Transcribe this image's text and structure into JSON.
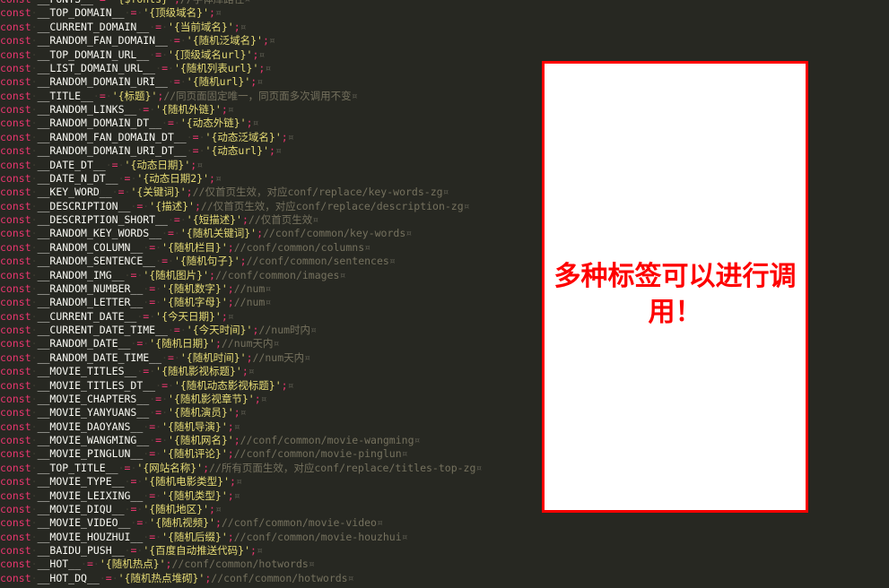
{
  "editor": {
    "theme_background": "#272822",
    "keyword_color": "#e8366f",
    "string_color": "#e6db74",
    "comment_color": "#75715e",
    "identifier_color": "#f8f8f2",
    "keyword": "const",
    "assign": "=",
    "terminator": ";",
    "quote": "'",
    "eol_mark": "¤",
    "lines": [
      {
        "name": "__FONTS__",
        "value": "{$fonts}",
        "comment": "//字体库路径"
      },
      {
        "name": "__TOP_DOMAIN__",
        "value": "{顶级域名}",
        "comment": ""
      },
      {
        "name": "__CURRENT_DOMAIN__",
        "value": "{当前域名}",
        "comment": ""
      },
      {
        "name": "__RANDOM_FAN_DOMAIN__",
        "value": "{随机泛域名}",
        "comment": ""
      },
      {
        "name": "__TOP_DOMAIN_URL__",
        "value": "{顶级域名url}",
        "comment": ""
      },
      {
        "name": "__LIST_DOMAIN_URL__",
        "value": "{随机列表url}",
        "comment": ""
      },
      {
        "name": "__RANDOM_DOMAIN_URI__",
        "value": "{随机url}",
        "comment": ""
      },
      {
        "name": "__TITLE__",
        "value": "{标题}",
        "comment": "//同页面固定唯一，同页面多次调用不变"
      },
      {
        "name": "__RANDOM_LINKS__",
        "value": "{随机外链}",
        "comment": ""
      },
      {
        "name": "__RANDOM_DOMAIN_DT__",
        "value": "{动态外链}",
        "comment": ""
      },
      {
        "name": "__RANDOM_FAN_DOMAIN_DT__",
        "value": "{动态泛域名}",
        "comment": ""
      },
      {
        "name": "__RANDOM_DOMAIN_URI_DT__",
        "value": "{动态url}",
        "comment": ""
      },
      {
        "name": "__DATE_DT__",
        "value": "{动态日期}",
        "comment": ""
      },
      {
        "name": "__DATE_N_DT__",
        "value": "{动态日期2}",
        "comment": ""
      },
      {
        "name": "__KEY_WORD__",
        "value": "{关键词}",
        "comment": "//仅首页生效，对应conf/replace/key-words-zg"
      },
      {
        "name": "__DESCRIPTION__",
        "value": "{描述}",
        "comment": "//仅首页生效，对应conf/replace/description-zg"
      },
      {
        "name": "__DESCRIPTION_SHORT__",
        "value": "{短描述}",
        "comment": "//仅首页生效"
      },
      {
        "name": "__RANDOM_KEY_WORDS__",
        "value": "{随机关键词}",
        "comment": "//conf/common/key-words"
      },
      {
        "name": "__RANDOM_COLUMN__",
        "value": "{随机栏目}",
        "comment": "//conf/common/columns"
      },
      {
        "name": "__RANDOM_SENTENCE__",
        "value": "{随机句子}",
        "comment": "//conf/common/sentences"
      },
      {
        "name": "__RANDOM_IMG__",
        "value": "{随机图片}",
        "comment": "//conf/common/images"
      },
      {
        "name": "__RANDOM_NUMBER__",
        "value": "{随机数字}",
        "comment": "//num"
      },
      {
        "name": "__RANDOM_LETTER__",
        "value": "{随机字母}",
        "comment": "//num"
      },
      {
        "name": "__CURRENT_DATE__",
        "value": "{今天日期}",
        "comment": ""
      },
      {
        "name": "__CURRENT_DATE_TIME__",
        "value": "{今天时间}",
        "comment": "//num时内"
      },
      {
        "name": "__RANDOM_DATE__",
        "value": "{随机日期}",
        "comment": "//num天内"
      },
      {
        "name": "__RANDOM_DATE_TIME__",
        "value": "{随机时间}",
        "comment": "//num天内"
      },
      {
        "name": "__MOVIE_TITLES__",
        "value": "{随机影视标题}",
        "comment": ""
      },
      {
        "name": "__MOVIE_TITLES_DT__",
        "value": "{随机动态影视标题}",
        "comment": ""
      },
      {
        "name": "__MOVIE_CHAPTERS__",
        "value": "{随机影视章节}",
        "comment": ""
      },
      {
        "name": "__MOVIE_YANYUANS__",
        "value": "{随机演员}",
        "comment": ""
      },
      {
        "name": "__MOVIE_DAOYANS__",
        "value": "{随机导演}",
        "comment": ""
      },
      {
        "name": "__MOVIE_WANGMING__",
        "value": "{随机网名}",
        "comment": "//conf/common/movie-wangming"
      },
      {
        "name": "__MOVIE_PINGLUN__",
        "value": "{随机评论}",
        "comment": "//conf/common/movie-pinglun"
      },
      {
        "name": "__TOP_TITLE__",
        "value": "{网站名称}",
        "comment": "//所有页面生效，对应conf/replace/titles-top-zg"
      },
      {
        "name": "__MOVIE_TYPE__",
        "value": "{随机电影类型}",
        "comment": ""
      },
      {
        "name": "__MOVIE_LEIXING__",
        "value": "{随机类型}",
        "comment": ""
      },
      {
        "name": "__MOVIE_DIQU__",
        "value": "{随机地区}",
        "comment": ""
      },
      {
        "name": "__MOVIE_VIDEO__",
        "value": "{随机视频}",
        "comment": "//conf/common/movie-video"
      },
      {
        "name": "__MOVIE_HOUZHUI__",
        "value": "{随机后缀}",
        "comment": "//conf/common/movie-houzhui"
      },
      {
        "name": "__BAIDU_PUSH__",
        "value": "{百度自动推送代码}",
        "comment": ""
      },
      {
        "name": "__HOT__",
        "value": "{随机热点}",
        "comment": "//conf/common/hotwords"
      },
      {
        "name": "__HOT_DQ__",
        "value": "{随机热点堆砌}",
        "comment": "//conf/common/hotwords"
      }
    ]
  },
  "annotation": {
    "text": "多种标签可以进行调用！",
    "border_color": "#fe0000",
    "text_color": "#fe0000",
    "background_color": "#ffffff"
  }
}
